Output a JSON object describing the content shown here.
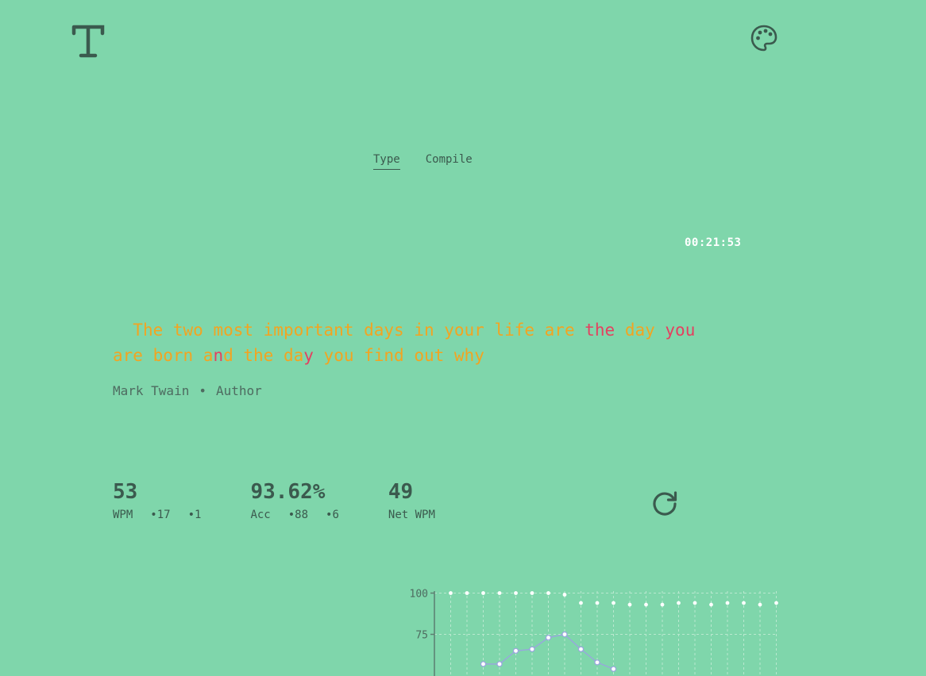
{
  "header": {
    "logo_icon": "typewriter-T-icon",
    "theme_icon": "palette-icon"
  },
  "tabs": [
    {
      "label": "Type",
      "active": true
    },
    {
      "label": "Compile",
      "active": false
    }
  ],
  "timer": "00:21:53",
  "quote": {
    "segments": [
      {
        "text": "The two most important days in your life are ",
        "error": false
      },
      {
        "text": "the",
        "error": true
      },
      {
        "text": " day ",
        "error": false
      },
      {
        "text": "you",
        "error": true
      },
      {
        "text": " are born a",
        "error": false
      },
      {
        "text": "n",
        "error": true
      },
      {
        "text": "d the da",
        "error": false
      },
      {
        "text": "y",
        "error": true
      },
      {
        "text": " you find out why",
        "error": false
      }
    ]
  },
  "author": {
    "name": "Mark Twain",
    "separator": "•",
    "role": "Author"
  },
  "stats": {
    "wpm": {
      "value": "53",
      "label": "WPM",
      "sub1": "•17",
      "sub2": "•1"
    },
    "acc": {
      "value": "93.62%",
      "label": "Acc",
      "sub1": "•88",
      "sub2": "•6"
    },
    "net": {
      "value": "49",
      "label": "Net WPM"
    }
  },
  "restart_icon": "restart-icon",
  "colors": {
    "background": "#7fd6ab",
    "typed": "#f2a421",
    "error": "#e4405f",
    "text": "#3b5a4e",
    "timer": "#ffffff",
    "wpm_line": "#9aa3e0"
  },
  "chart_data": {
    "type": "line",
    "yticks_visible": [
      "100",
      "75"
    ],
    "ylim_visible": [
      64,
      100
    ],
    "x": [
      1,
      2,
      3,
      4,
      5,
      6,
      7,
      8,
      9,
      10,
      11,
      12,
      13,
      14,
      15,
      16,
      17,
      18,
      19,
      20,
      21
    ],
    "series": [
      {
        "values": [
          null,
          null,
          57,
          57,
          65,
          66,
          73,
          75,
          66,
          58,
          54,
          null,
          null,
          null,
          null,
          null,
          null,
          null,
          null,
          null,
          null
        ]
      },
      {
        "values": [
          100,
          100,
          100,
          100,
          100,
          100,
          100,
          99,
          94,
          94,
          94,
          93,
          93,
          93,
          94,
          94,
          93,
          94,
          94,
          93,
          94
        ]
      }
    ]
  }
}
